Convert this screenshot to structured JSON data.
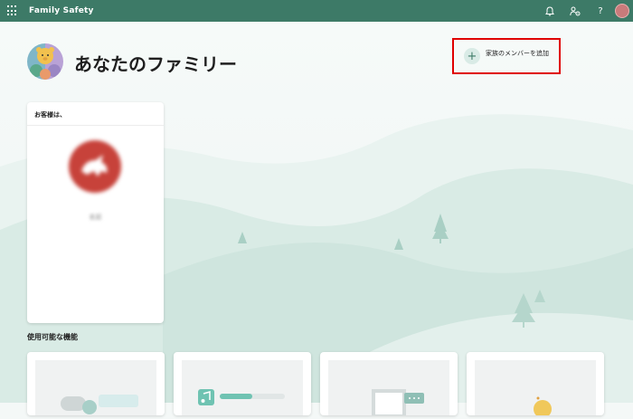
{
  "header": {
    "app_title": "Family Safety",
    "help_label": "?"
  },
  "main": {
    "page_title": "あなたのファミリー",
    "add_member_label": "家族のメンバーを追加",
    "add_member_plus": "+"
  },
  "user_card": {
    "header": "お客様は、",
    "name": "名前"
  },
  "features": {
    "section_title": "使用可能な機能"
  },
  "colors": {
    "header_bg": "#3d7a67",
    "highlight": "#e00000",
    "avatar_red": "#c7423a"
  }
}
